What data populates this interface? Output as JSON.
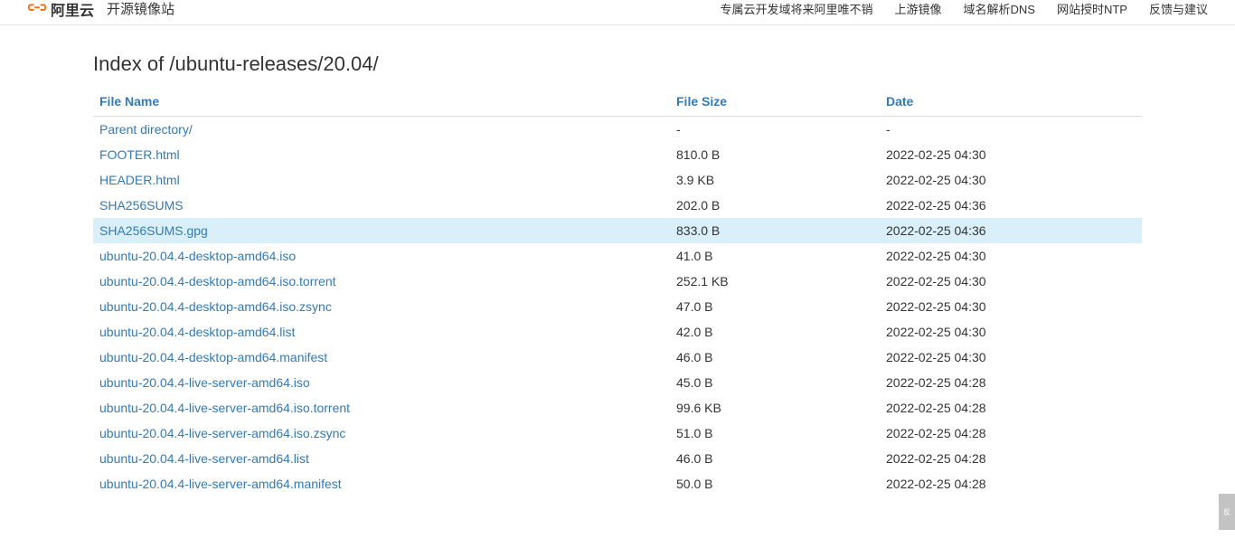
{
  "header": {
    "logo_text": "阿里云",
    "site_name": "开源镜像站",
    "nav": [
      "专属云开发域将来阿里唯不销",
      "上游镜像",
      "域名解析DNS",
      "网站授时NTP",
      "反馈与建议"
    ]
  },
  "page": {
    "title": "Index of /ubuntu-releases/20.04/"
  },
  "table": {
    "headers": {
      "name": "File Name",
      "size": "File Size",
      "date": "Date"
    },
    "rows": [
      {
        "name": "Parent directory/",
        "size": "-",
        "date": "-",
        "highlight": false
      },
      {
        "name": "FOOTER.html",
        "size": "810.0 B",
        "date": "2022-02-25 04:30",
        "highlight": false
      },
      {
        "name": "HEADER.html",
        "size": "3.9 KB",
        "date": "2022-02-25 04:30",
        "highlight": false
      },
      {
        "name": "SHA256SUMS",
        "size": "202.0 B",
        "date": "2022-02-25 04:36",
        "highlight": false
      },
      {
        "name": "SHA256SUMS.gpg",
        "size": "833.0 B",
        "date": "2022-02-25 04:36",
        "highlight": true
      },
      {
        "name": "ubuntu-20.04.4-desktop-amd64.iso",
        "size": "41.0 B",
        "date": "2022-02-25 04:30",
        "highlight": false
      },
      {
        "name": "ubuntu-20.04.4-desktop-amd64.iso.torrent",
        "size": "252.1 KB",
        "date": "2022-02-25 04:30",
        "highlight": false
      },
      {
        "name": "ubuntu-20.04.4-desktop-amd64.iso.zsync",
        "size": "47.0 B",
        "date": "2022-02-25 04:30",
        "highlight": false
      },
      {
        "name": "ubuntu-20.04.4-desktop-amd64.list",
        "size": "42.0 B",
        "date": "2022-02-25 04:30",
        "highlight": false
      },
      {
        "name": "ubuntu-20.04.4-desktop-amd64.manifest",
        "size": "46.0 B",
        "date": "2022-02-25 04:30",
        "highlight": false
      },
      {
        "name": "ubuntu-20.04.4-live-server-amd64.iso",
        "size": "45.0 B",
        "date": "2022-02-25 04:28",
        "highlight": false
      },
      {
        "name": "ubuntu-20.04.4-live-server-amd64.iso.torrent",
        "size": "99.6 KB",
        "date": "2022-02-25 04:28",
        "highlight": false
      },
      {
        "name": "ubuntu-20.04.4-live-server-amd64.iso.zsync",
        "size": "51.0 B",
        "date": "2022-02-25 04:28",
        "highlight": false
      },
      {
        "name": "ubuntu-20.04.4-live-server-amd64.list",
        "size": "46.0 B",
        "date": "2022-02-25 04:28",
        "highlight": false
      },
      {
        "name": "ubuntu-20.04.4-live-server-amd64.manifest",
        "size": "50.0 B",
        "date": "2022-02-25 04:28",
        "highlight": false
      }
    ]
  },
  "side_widget": "反"
}
